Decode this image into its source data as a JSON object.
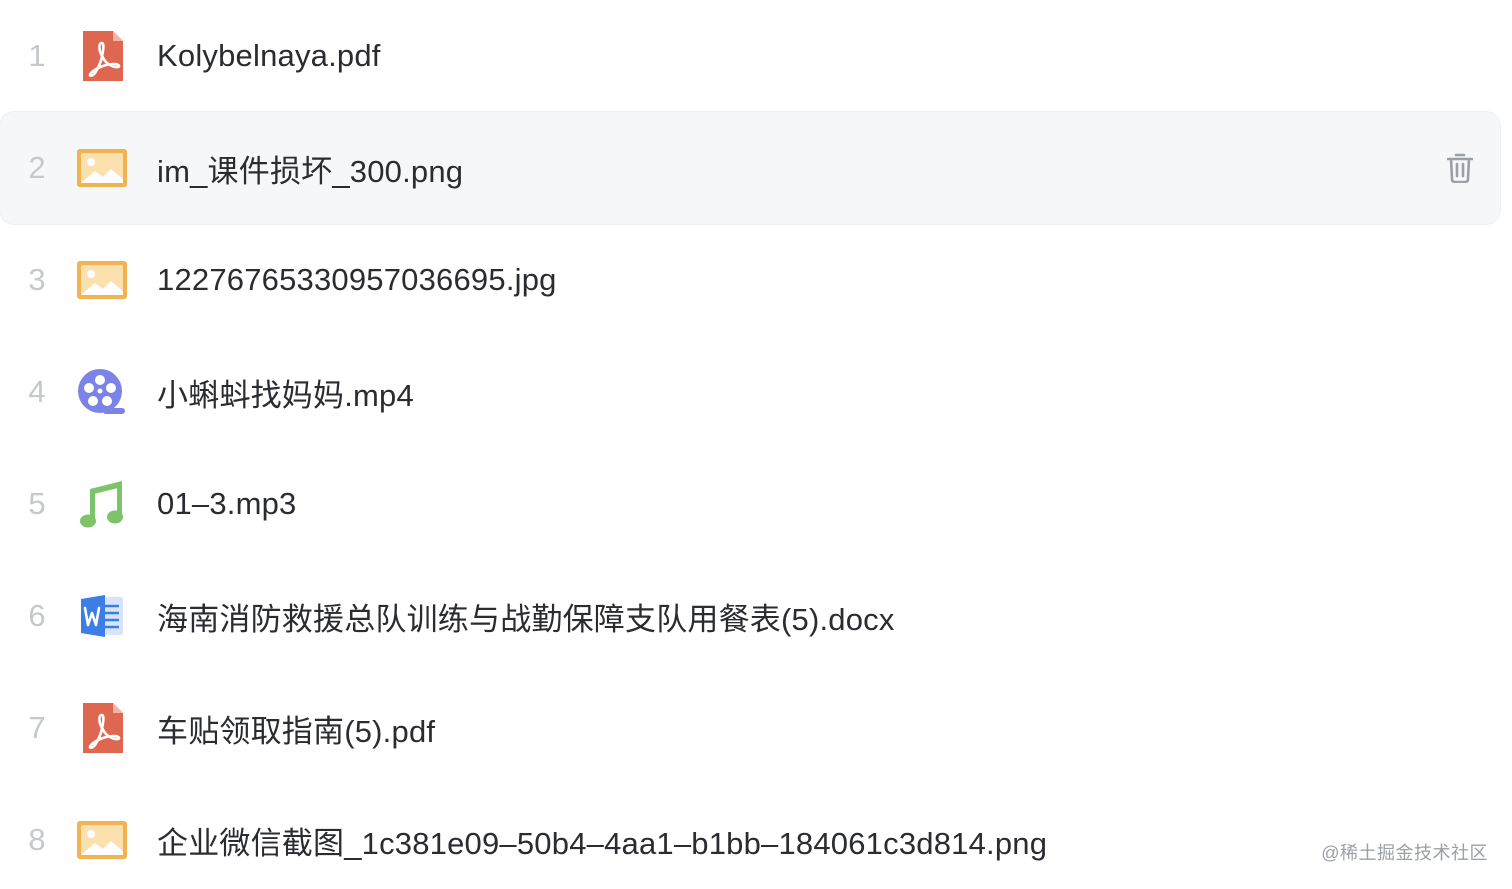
{
  "files": [
    {
      "index": "1",
      "name": "Kolybelnaya.pdf",
      "type": "pdf-icon"
    },
    {
      "index": "2",
      "name": "im_课件损坏_300.png",
      "type": "image-icon"
    },
    {
      "index": "3",
      "name": "1227676533095703669​5.jpg",
      "type": "image-icon"
    },
    {
      "index": "4",
      "name": "小蝌蚪找妈妈.mp4",
      "type": "video-icon"
    },
    {
      "index": "5",
      "name": "01–3.mp3",
      "type": "audio-icon"
    },
    {
      "index": "6",
      "name": "海南消防救援总队训练与战勤保障支队用餐表(5).docx",
      "type": "word-icon"
    },
    {
      "index": "7",
      "name": "车贴领取指南(5).pdf",
      "type": "pdf-icon"
    },
    {
      "index": "8",
      "name": "企业微信截图_1c381e09–50b4–4aa1–b1bb–184061c3d814.png",
      "type": "image-icon"
    }
  ],
  "hovered_row_index": "2",
  "watermark": "@稀土掘金技术社区",
  "colors": {
    "pdf": "#e0674f",
    "image": "#f1b24f",
    "video": "#7b84e6",
    "audio": "#7cc36a",
    "word": "#3d7ee6",
    "index_text": "#c4c8cf",
    "name_text": "#2a2c31",
    "hover_bg": "#f6f7f9"
  }
}
